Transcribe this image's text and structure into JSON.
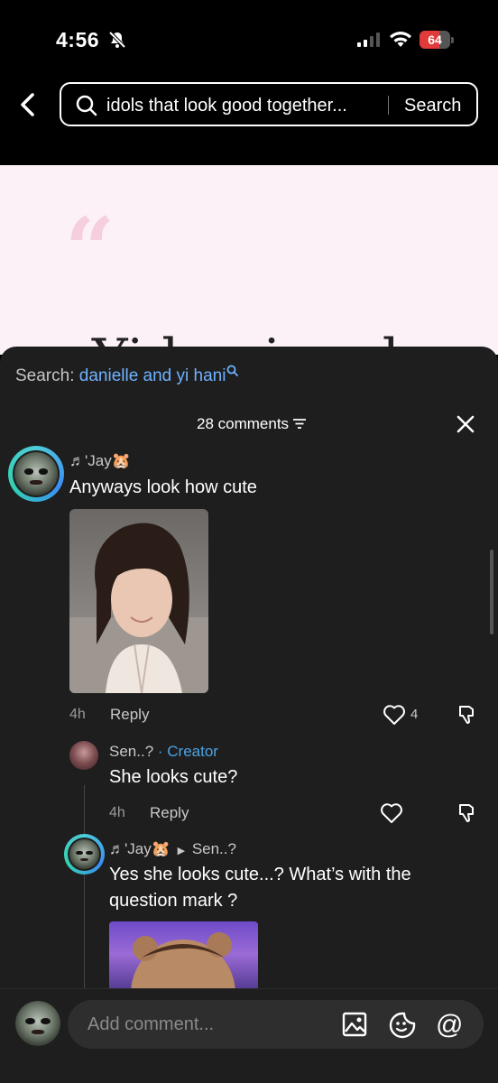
{
  "status_bar": {
    "time": "4:56",
    "battery": "64",
    "battery_level": 0.64
  },
  "header": {
    "search_query": "idols that look good together...",
    "search_button": "Search"
  },
  "background": {
    "quote_mark": "“",
    "heading": "Yi hani and"
  },
  "sheet": {
    "search_label": "Search:",
    "search_term": "danielle and yi hani",
    "comments_count": "28 comments"
  },
  "comments": [
    {
      "user": "♬'Jay🐹",
      "text": "Anyways look how cute",
      "time": "4h",
      "reply_label": "Reply",
      "likes": "4"
    },
    {
      "user": "Sen..?",
      "creator_label": "· Creator",
      "text": "She looks cute?",
      "time": "4h",
      "reply_label": "Reply"
    },
    {
      "user": "♬'Jay🐹",
      "reply_to": "Sen..?",
      "text": "Yes she looks cute...? What’s with the question mark ?"
    }
  ],
  "input": {
    "placeholder": "Add comment...",
    "mention_symbol": "@"
  },
  "icons": [
    "bell-slash-icon",
    "signal-icon",
    "wifi-icon",
    "battery-icon",
    "back-arrow-icon",
    "search-icon",
    "sort-icon",
    "close-icon",
    "heart-icon",
    "dislike-icon",
    "image-icon",
    "emoji-icon",
    "mention-icon"
  ],
  "colors": {
    "link_blue": "#6fb2ff",
    "creator_blue": "#4aa3e6",
    "battery_red": "#e03a3a",
    "sheet_bg": "#1e1e1e"
  }
}
